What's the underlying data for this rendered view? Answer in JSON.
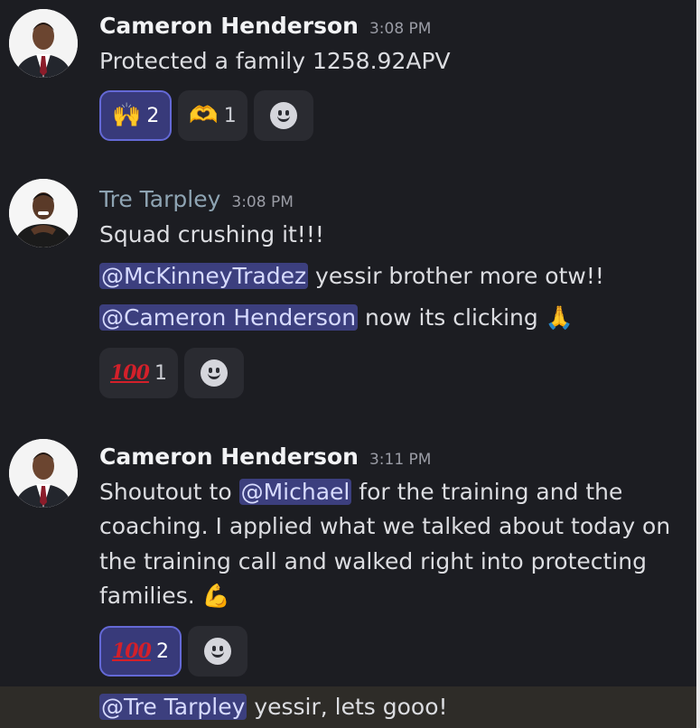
{
  "messages": [
    {
      "author": "Cameron Henderson",
      "time": "3:08 PM",
      "lines": [
        "Protected a family 1258.92APV"
      ],
      "reactions": [
        {
          "emoji": "🙌",
          "count": "2",
          "active": true
        },
        {
          "emoji": "🫶",
          "count": "1",
          "active": false
        }
      ]
    },
    {
      "author": "Tre Tarpley",
      "time": "3:08 PM",
      "lines": [
        "Squad crushing it!!!"
      ],
      "mention_lines": [
        {
          "mention": "@McKinneyTradez",
          "text": " yessir brother more otw!!"
        },
        {
          "mention": "@Cameron Henderson",
          "text": " now its clicking",
          "emoji": "🙏"
        }
      ],
      "reactions": [
        {
          "emoji": "100",
          "count": "1",
          "active": false
        }
      ]
    },
    {
      "author": "Cameron Henderson",
      "time": "3:11 PM",
      "line1_prefix": "Shoutout to ",
      "line1_mention": "@Michael",
      "line1_suffix": " for the training and the",
      "lines": [
        "coaching. I applied what we talked about today on",
        "the training call and walked right into protecting",
        "families."
      ],
      "end_emoji": "💪",
      "reactions": [
        {
          "emoji": "100",
          "count": "2",
          "active": true
        }
      ]
    }
  ],
  "reply": {
    "mention": "@Tre Tarpley",
    "text": " yessir, lets gooo!"
  },
  "colors": {
    "background": "#1c1d22",
    "mention_bg": "#3c3f7e",
    "active_reaction": "#383a7a"
  },
  "icons": [
    "add-reaction-smiley-icon"
  ]
}
